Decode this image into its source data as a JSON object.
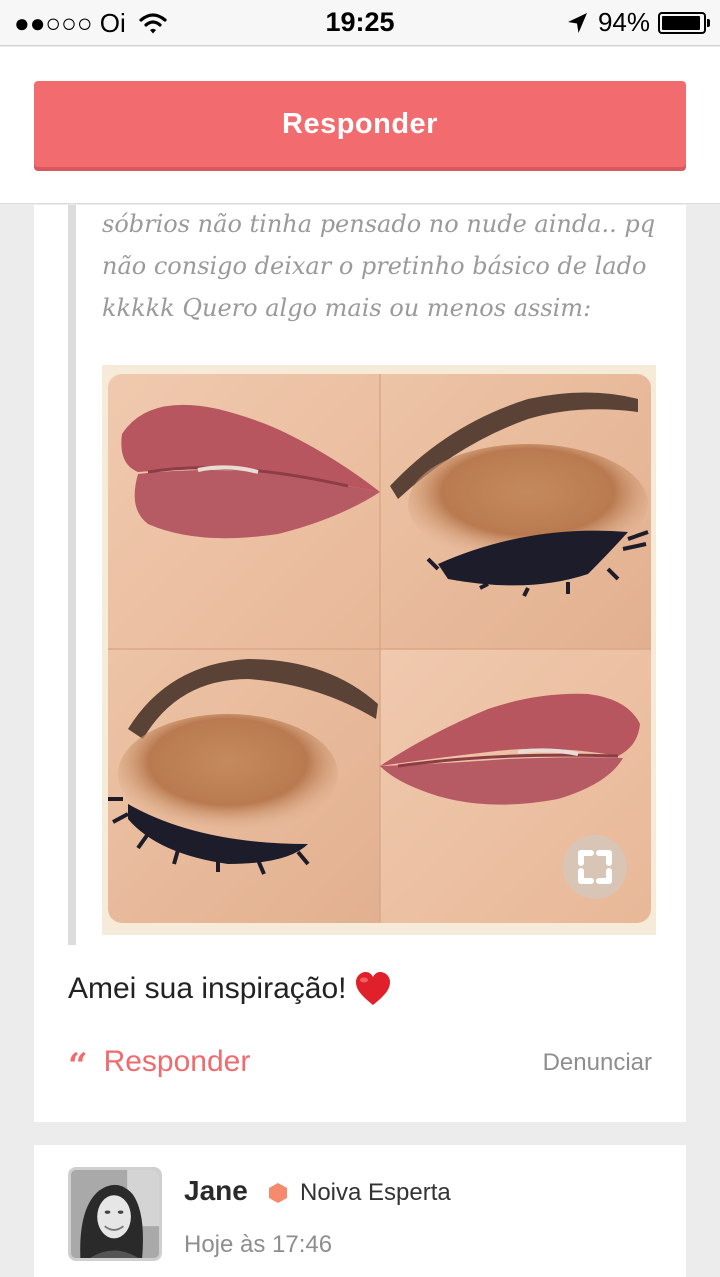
{
  "status_bar": {
    "carrier": "●●○○○ Oi",
    "time": "19:25",
    "battery_percent": "94%",
    "battery_level": 0.94
  },
  "top_bar": {
    "reply_button_label": "Responder",
    "accent_color": "#f26b6f"
  },
  "post": {
    "quote_lines": [
      "sóbrios não tinha pensado no nude ainda.. pq",
      "não consigo deixar o pretinho básico de lado",
      "kkkkk Quero algo mais ou menos assim:"
    ],
    "comment": "Amei sua inspiração!",
    "comment_emoji": "heart-icon",
    "reply_label": "Responder",
    "reply_icon": "“",
    "report_label": "Denunciar"
  },
  "next_post": {
    "author": "Jane",
    "badge": "Noiva Esperta",
    "badge_color": "#f58a6d",
    "timestamp": "Hoje às 17:46"
  }
}
